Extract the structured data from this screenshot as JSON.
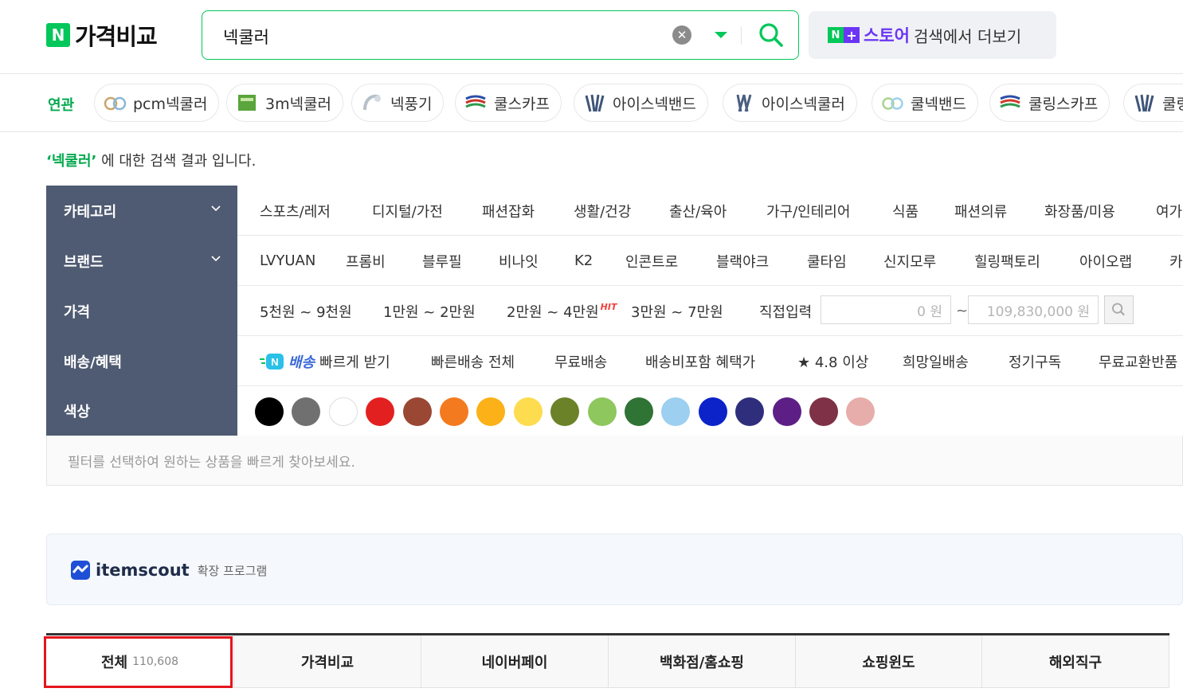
{
  "header": {
    "logo_n": "N",
    "logo_text": "가격비교",
    "search_value": "넥쿨러",
    "store_badge_n": "N",
    "store_badge_plus": "+",
    "store_name": "스토어",
    "store_more": "검색에서 더보기"
  },
  "related": {
    "label": "연관",
    "items": [
      "pcm넥쿨러",
      "3m넥쿨러",
      "넥풍기",
      "쿨스카프",
      "아이스넥밴드",
      "아이스넥쿨러",
      "쿨넥밴드",
      "쿨링스카프",
      "쿨링"
    ]
  },
  "result": {
    "keyword": "‘넥쿨러’",
    "suffix": " 에 대한 검색 결과 입니다."
  },
  "filters": {
    "category_label": "카테고리",
    "categories": [
      "스포츠/레저",
      "디지털/가전",
      "패션잡화",
      "생활/건강",
      "출산/육아",
      "가구/인테리어",
      "식품",
      "패션의류",
      "화장품/미용",
      "여가"
    ],
    "brand_label": "브랜드",
    "brands": [
      "LVYUAN",
      "프롬비",
      "블루필",
      "비나잇",
      "K2",
      "인콘트로",
      "블랙야크",
      "쿨타임",
      "신지모루",
      "힐링팩토리",
      "아이오랩",
      "카"
    ],
    "price_label": "가격",
    "prices": [
      "5천원 ~ 9천원",
      "1만원 ~ 2만원",
      "2만원 ~ 4만원",
      "3만원 ~ 7만원"
    ],
    "hit_badge": "HIT",
    "direct_input": "직접입력",
    "price_min": "0 원",
    "price_sep": "~",
    "price_max": "109,830,000 원",
    "delivery_label": "배송/혜택",
    "fast_delivery_brand": "배송",
    "fast_delivery_text": "빠르게 받기",
    "deliveries": [
      "빠른배송 전체",
      "무료배송",
      "배송비포함 혜택가",
      "★ 4.8 이상",
      "희망일배송",
      "정기구독",
      "무료교환반품"
    ],
    "color_label": "색상",
    "colors": [
      "#000000",
      "#707070",
      "#ffffff",
      "#e32020",
      "#9a4733",
      "#f47a1f",
      "#fbb117",
      "#fddc4f",
      "#6b8229",
      "#8dc75d",
      "#2f7335",
      "#9ccff0",
      "#0b23c9",
      "#2f2e7d",
      "#5d1f86",
      "#7e3147",
      "#e7adaa"
    ],
    "hint": "필터를 선택하여 원하는 상품을 빠르게 찾아보세요."
  },
  "itemscout": {
    "name": "itemscout",
    "sub": "확장 프로그램"
  },
  "tabs": [
    {
      "label": "전체",
      "count": "110,608"
    },
    {
      "label": "가격비교",
      "count": ""
    },
    {
      "label": "네이버페이",
      "count": ""
    },
    {
      "label": "백화점/홈쇼핑",
      "count": ""
    },
    {
      "label": "쇼핑윈도",
      "count": ""
    },
    {
      "label": "해외직구",
      "count": ""
    }
  ]
}
